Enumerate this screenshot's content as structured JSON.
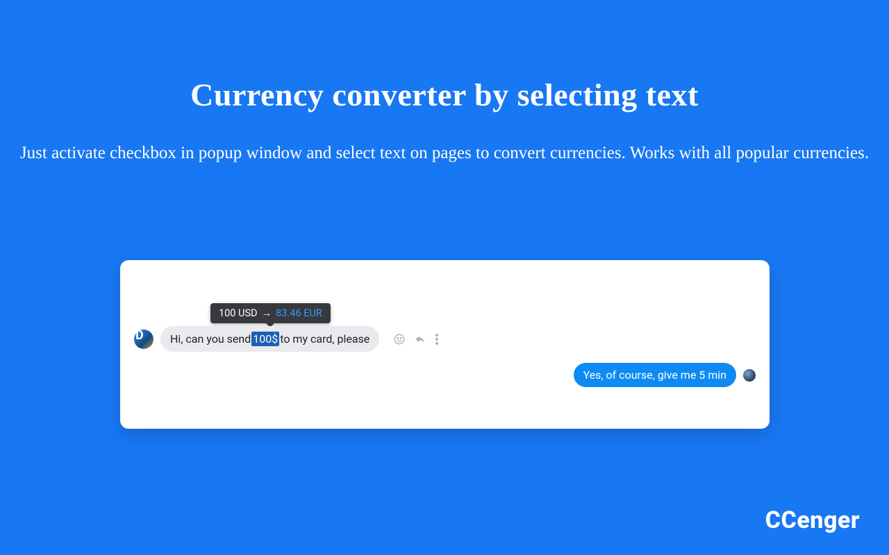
{
  "header": {
    "title": "Currency converter by selecting text",
    "subtitle": "Just activate checkbox in popup window and select text on pages to convert currencies. Works with all popular currencies."
  },
  "tooltip": {
    "source": "100 USD",
    "arrow": "→",
    "converted": "83.46 EUR"
  },
  "chat": {
    "incoming": {
      "avatar_letter": "D",
      "text_before": "Hi, can you send ",
      "selected": "100$",
      "text_after": " to my card, please"
    },
    "outgoing": {
      "text": "Yes, of course, give me 5 min"
    }
  },
  "brand": "CCenger"
}
